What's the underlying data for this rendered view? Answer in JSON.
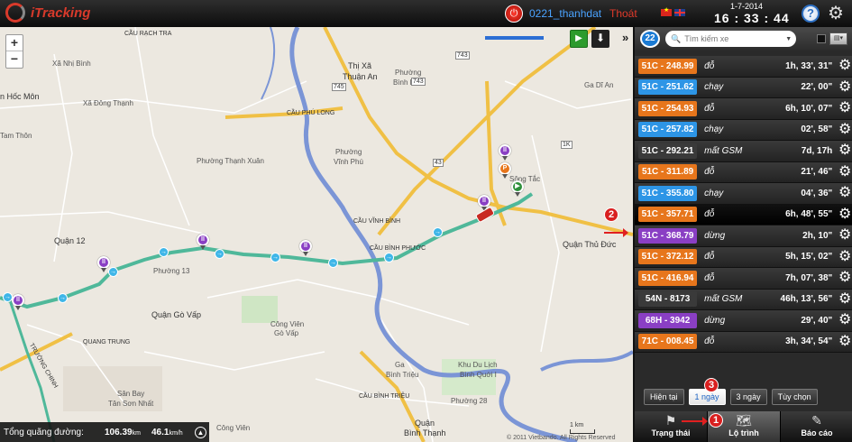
{
  "header": {
    "logo_text": "iTracking",
    "username": "0221_thanhdat",
    "logout_label": "Thoát",
    "date": "1-7-2014",
    "time": "16 : 33 : 44",
    "help_label": "?"
  },
  "map": {
    "zoom_in": "+",
    "zoom_out": "−",
    "distance_label": "Tổng quãng đường:",
    "distance_value": "106.39",
    "distance_unit": "km",
    "speed_value": "46.1",
    "speed_unit": "km/h",
    "scale_label": "1 km",
    "copyright": "© 2011 Vietbando. All Rights Reserved",
    "labels": {
      "cau_rach_tra": "CẦU RẠCH TRA",
      "xa_nhi_binh": "Xã Nhị Bình",
      "hoc_mon": "n Hốc Môn",
      "xa_dong_thanh": "Xã Đông Thạnh",
      "tam_thon": "Tam Thôn",
      "thi_xa": "Thị Xã",
      "thuan_an": "Thuận An",
      "phuong_binh_hoa": "Phường",
      "binh_hoa": "Bình Hòa",
      "cau_phu_long": "CẦU PHÚ LONG",
      "ga_di_an": "Ga Dĩ An",
      "phuong_thanh_xuan": "Phường Thạnh Xuân",
      "phuong_vinh_phu_1": "Phường",
      "phuong_vinh_phu_2": "Vĩnh Phú",
      "song_tac": "Sông Tắc",
      "cau_vinh_binh": "CẦU VĨNH BÌNH",
      "cau_binh_phuoc": "CẦU BÌNH PHƯỚC",
      "quan_12": "Quận 12",
      "phuong_13": "Phường 13",
      "quan_thu_duc": "Quận Thủ Đức",
      "quan_go_vap": "Quận Gò Vấp",
      "quang_trung": "QUANG TRUNG",
      "cong_vien_1": "Công Viên",
      "cong_vien_2": "Gò Vấp",
      "ga_binh_trieu_1": "Ga",
      "ga_binh_trieu_2": "Bình Triệu",
      "cau_binh_trieu": "CẦU BÌNH TRIỆU",
      "khu_du_lich_1": "Khu Du Lịch",
      "khu_du_lich_2": "Bình Quới I",
      "phuong_28": "Phường 28",
      "san_bay_1": "Sân Bay",
      "san_bay_2": "Tân Sơn Nhất",
      "quan_binh_thanh": "Quận",
      "binh_thanh": "Bình Thạnh",
      "cong_vien_3": "Công Viên",
      "truong_chinh": "TRƯỜNG CHINH",
      "r743a": "743",
      "r743b": "743",
      "r745": "745",
      "r43": "43",
      "r1k": "1K"
    }
  },
  "callouts": [
    "1",
    "2",
    "3"
  ],
  "panel": {
    "vehicle_count": "22",
    "search_placeholder": "Tìm kiếm xe",
    "vehicles": [
      {
        "plate": "51C - 248.99",
        "status": "đỗ",
        "duration": "1h, 33', 31\"",
        "color": "#e7761c"
      },
      {
        "plate": "51C - 251.62",
        "status": "chạy",
        "duration": "22', 00\"",
        "color": "#2d95e6"
      },
      {
        "plate": "51C - 254.93",
        "status": "đỗ",
        "duration": "6h, 10', 07\"",
        "color": "#e7761c"
      },
      {
        "plate": "51C - 257.82",
        "status": "chạy",
        "duration": "02', 58\"",
        "color": "#2d95e6"
      },
      {
        "plate": "51C - 292.21",
        "status": "mất GSM",
        "duration": "7d, 17h",
        "color": "#3a3a3a"
      },
      {
        "plate": "51C - 311.89",
        "status": "đỗ",
        "duration": "21', 46\"",
        "color": "#e7761c"
      },
      {
        "plate": "51C - 355.80",
        "status": "chạy",
        "duration": "04', 36\"",
        "color": "#2d95e6"
      },
      {
        "plate": "51C - 357.71",
        "status": "đỗ",
        "duration": "6h, 48', 55\"",
        "color": "#e7761c"
      },
      {
        "plate": "51C - 368.79",
        "status": "dừng",
        "duration": "2h, 10\"",
        "color": "#8a3fc4"
      },
      {
        "plate": "51C - 372.12",
        "status": "đỗ",
        "duration": "5h, 15', 02\"",
        "color": "#e7761c"
      },
      {
        "plate": "51C - 416.94",
        "status": "đỗ",
        "duration": "7h, 07', 38\"",
        "color": "#e7761c"
      },
      {
        "plate": "54N - 8173",
        "status": "mất GSM",
        "duration": "46h, 13', 56\"",
        "color": "#3a3a3a"
      },
      {
        "plate": "68H - 3942",
        "status": "dừng",
        "duration": "29', 40\"",
        "color": "#8a3fc4"
      },
      {
        "plate": "71C - 008.45",
        "status": "đỗ",
        "duration": "3h, 34', 54\"",
        "color": "#e7761c"
      }
    ],
    "period_buttons": [
      "Hiện tại",
      "1 ngày",
      "3 ngày",
      "Tùy chọn"
    ],
    "active_period": 1,
    "tabs": [
      "Trạng thái",
      "Lộ trình",
      "Báo cáo"
    ],
    "active_tab": 1
  },
  "colors": {
    "route": "#4fb89a",
    "river": "#7b95d6",
    "highway": "#f0c045",
    "accent": "#d92020"
  }
}
